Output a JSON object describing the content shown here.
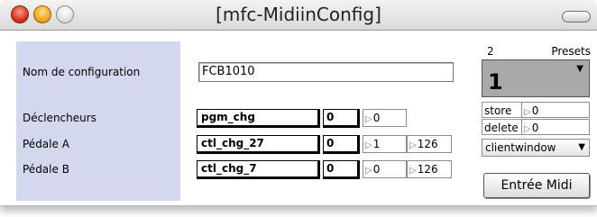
{
  "window": {
    "title": "[mfc-MidiinConfig]"
  },
  "config": {
    "label": "Nom de configuration",
    "value": "FCB1010"
  },
  "rows": [
    {
      "label": "Déclencheurs",
      "message": "pgm_chg",
      "number": "0",
      "out1": "0"
    },
    {
      "label": "Pédale A",
      "message": "ctl_chg_27",
      "number": "0",
      "out1": "1",
      "out2": "126"
    },
    {
      "label": "Pédale B",
      "message": "ctl_chg_7",
      "number": "0",
      "out1": "0",
      "out2": "126"
    }
  ],
  "presets": {
    "count": "2",
    "label": "Presets",
    "current": "1",
    "store_label": "store",
    "store_value": "0",
    "delete_label": "delete",
    "delete_value": "0",
    "menu_value": "clientwindow"
  },
  "midi_button_label": "Entrée Midi",
  "icons": {
    "outlet": "triangle-right-icon",
    "menu": "triangle-down-icon"
  }
}
